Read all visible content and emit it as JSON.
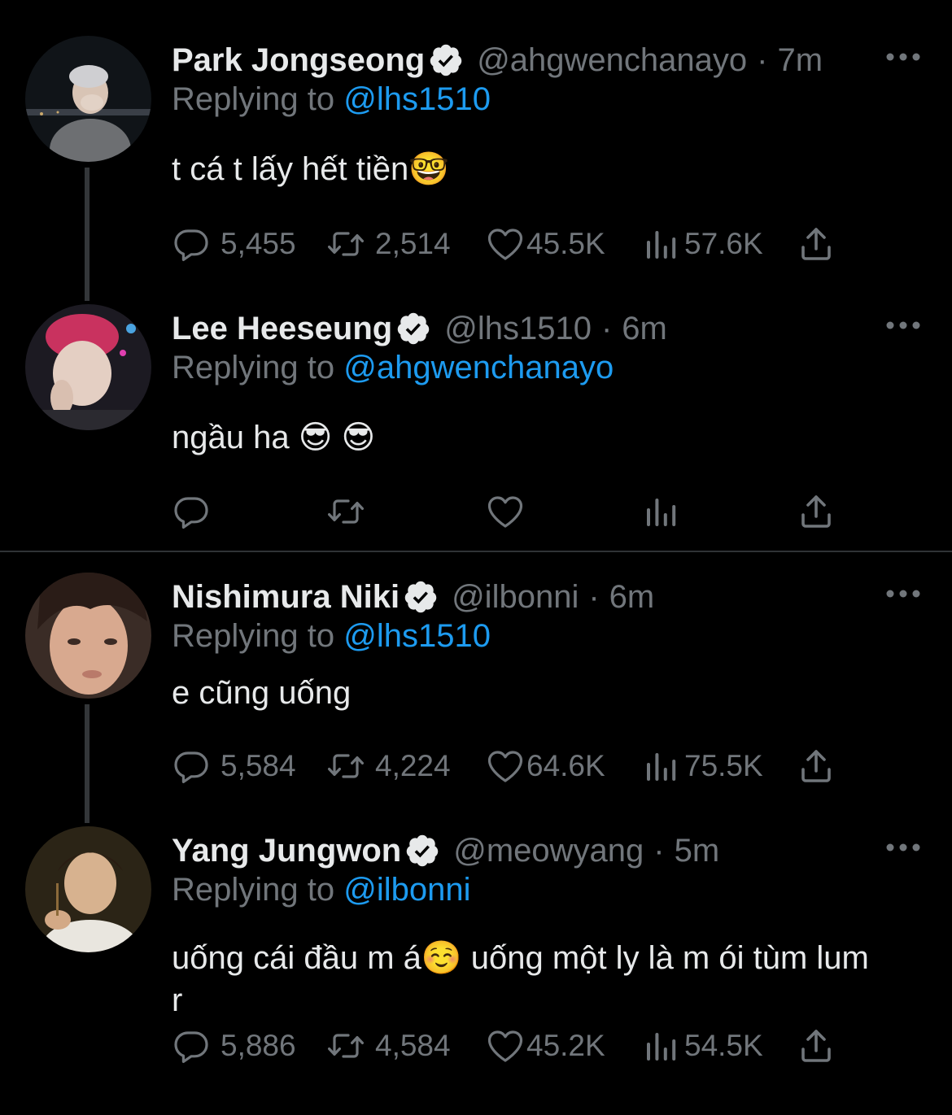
{
  "tweets": [
    {
      "name": "Park Jongseong",
      "handle": "@ahgwenchanayo",
      "dot": "·",
      "time": "7m",
      "replying_prefix": "Replying to ",
      "replying_to": "@lhs1510",
      "text": "t cá t lấy hết tiền🤓",
      "replies": "5,455",
      "retweets": "2,514",
      "likes": "45.5K",
      "views": "57.6K"
    },
    {
      "name": "Lee Heeseung",
      "handle": "@lhs1510",
      "dot": "·",
      "time": "6m",
      "replying_prefix": "Replying to ",
      "replying_to": "@ahgwenchanayo",
      "text": "ngầu ha 😎 😎",
      "replies": "",
      "retweets": "",
      "likes": "",
      "views": ""
    },
    {
      "name": "Nishimura Niki",
      "handle": "@ilbonni",
      "dot": "·",
      "time": "6m",
      "replying_prefix": "Replying to ",
      "replying_to": "@lhs1510",
      "text": "e cũng uống",
      "replies": "5,584",
      "retweets": "4,224",
      "likes": "64.6K",
      "views": "75.5K"
    },
    {
      "name": "Yang Jungwon",
      "handle": "@meowyang",
      "dot": "·",
      "time": "5m",
      "replying_prefix": "Replying to ",
      "replying_to": "@ilbonni",
      "text": "uống cái đầu m á☺️  uống một ly là m ói tùm lum r",
      "replies": "5,886",
      "retweets": "4,584",
      "likes": "45.2K",
      "views": "54.5K"
    }
  ],
  "icons": {
    "reply": "reply-icon",
    "retweet": "retweet-icon",
    "like": "heart-icon",
    "views": "views-icon",
    "share": "share-icon",
    "more": "more-icon",
    "verified": "verified-icon"
  },
  "colors": {
    "background": "#000000",
    "text": "#e7e9ea",
    "secondary": "#71767b",
    "link": "#1d9bf0",
    "thread_line": "#333639"
  }
}
